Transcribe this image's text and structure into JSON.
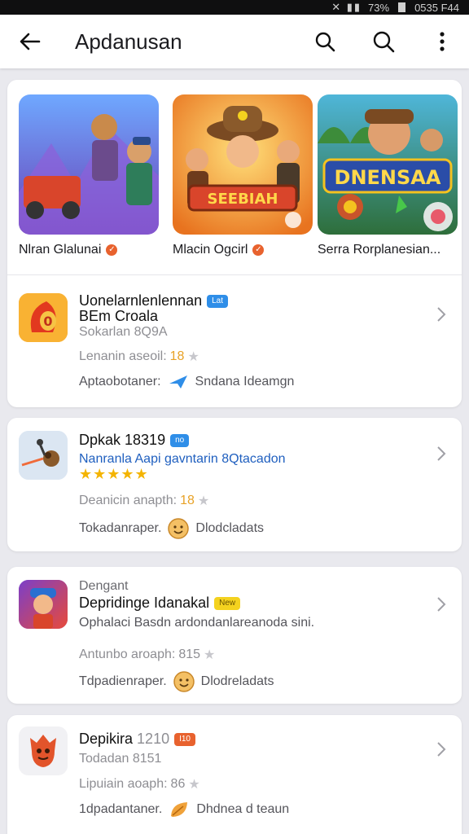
{
  "status": {
    "battery": "73%",
    "time": "0535 F44"
  },
  "app_bar": {
    "title": "Apdanusan"
  },
  "featured": [
    {
      "caption": "Nlran Glalunai"
    },
    {
      "caption": "Mlacin Ogcirl"
    },
    {
      "caption": "Serra Rorplanesian...",
      "art_title": "DNENSAA"
    }
  ],
  "featured_art_text": {
    "tile2": "SEEBIAH"
  },
  "apps": [
    {
      "title_line1": "Uonelarnlenlennan",
      "badge": "Lat",
      "badge_color": "#2f8ee8",
      "title_line2": "BEm Croala",
      "sub": "Sokarlan 8Q9A",
      "rating_label": "Lenanin aseoil:",
      "rating_value": "18",
      "dev_label": "Aptaobotaner:",
      "dev_name": "Sndana Ideamgn"
    },
    {
      "title": "Dpkak 18319",
      "badge": "no",
      "badge_color": "#2f8ee8",
      "sub_blue": "Nanranla Aapi gavntarin 8Qtacadon",
      "stars": "★★★★★",
      "rating_label": "Deanicin anapth:",
      "rating_value": "18",
      "dev_label": "Tokadanraper.",
      "dev_name": "Dlodcladats"
    },
    {
      "category": "Dengant",
      "title": "Depridinge Idanakal",
      "badge": "New",
      "badge_color": "#f4d21f",
      "desc": "Ophalaci Basdn ardondanlareanoda sini.",
      "rating_label": "Antunbo aroaph:",
      "rating_value": "815",
      "dev_label": "Tdpadienraper.",
      "dev_name": "Dlodreladats"
    },
    {
      "title": "Depikira",
      "title_num": "1210",
      "badge": "I10",
      "badge_color": "#e8622e",
      "sub": "Todadan 8151",
      "rating_label": "Lipuiain aoaph:",
      "rating_value": "86",
      "dev_label": "1dpadantaner.",
      "dev_name": "Dhdnea d teaun"
    }
  ]
}
